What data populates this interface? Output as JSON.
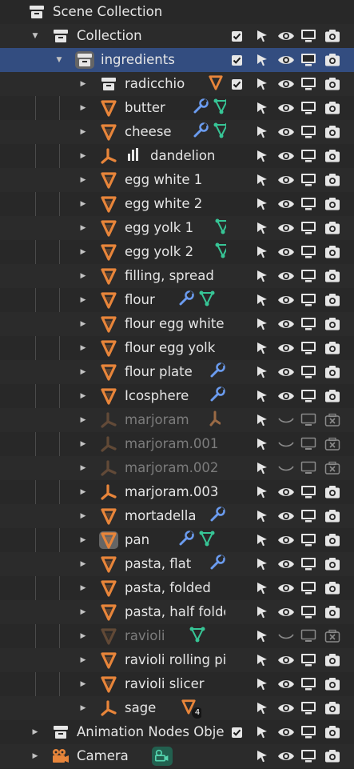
{
  "colors": {
    "background": "#282828",
    "selected_row": "#334d80",
    "mesh_icon": "#e8853a",
    "modifier_icon": "#6b9cf0",
    "vertex_group_icon": "#37c596",
    "control_icon": "#e6e6e6",
    "disabled_icon": "#8a8a8a"
  },
  "rows": [
    {
      "label": "Scene Collection",
      "depth": 0,
      "icon": "collection-icon",
      "expander": "none",
      "extras": [],
      "check": false,
      "controls": false,
      "dim": false,
      "selected": false
    },
    {
      "label": "Collection",
      "depth": 1,
      "icon": "collection-icon",
      "expander": "expanded",
      "extras": [],
      "check": true,
      "controls": true,
      "dim": false,
      "selected": false
    },
    {
      "label": "ingredients",
      "depth": 2,
      "icon": "collection-icon",
      "expander": "expanded",
      "extras": [],
      "check": true,
      "controls": true,
      "dim": false,
      "selected": true,
      "icon_highlight": true
    },
    {
      "label": "radicchio",
      "depth": 3,
      "icon": "collection-icon",
      "expander": "collapsed",
      "extras": [
        "mesh-data-icon"
      ],
      "check": true,
      "controls": true,
      "dim": false,
      "selected": false
    },
    {
      "label": "butter",
      "depth": 3,
      "icon": "mesh-object-icon",
      "expander": "collapsed",
      "extras": [
        "wrench-icon",
        "vertex-group-icon"
      ],
      "check": false,
      "controls": true,
      "dim": false,
      "selected": false
    },
    {
      "label": "cheese",
      "depth": 3,
      "icon": "mesh-object-icon",
      "expander": "collapsed",
      "extras": [
        "wrench-icon",
        "vertex-group-icon"
      ],
      "check": false,
      "controls": true,
      "dim": false,
      "selected": false
    },
    {
      "label": "dandelion",
      "depth": 3,
      "icon": "empty-object-icon",
      "expander": "collapsed",
      "extras": [
        "particles-icon"
      ],
      "check": false,
      "controls": true,
      "dim": false,
      "selected": false,
      "extras_before_name": true
    },
    {
      "label": "egg white 1",
      "depth": 3,
      "icon": "mesh-object-icon",
      "expander": "collapsed",
      "extras": [],
      "check": false,
      "controls": true,
      "dim": false,
      "selected": false
    },
    {
      "label": "egg white 2",
      "depth": 3,
      "icon": "mesh-object-icon",
      "expander": "collapsed",
      "extras": [],
      "check": false,
      "controls": true,
      "dim": false,
      "selected": false
    },
    {
      "label": "egg yolk 1",
      "depth": 3,
      "icon": "mesh-object-icon",
      "expander": "collapsed",
      "extras": [
        "vertex-group-icon"
      ],
      "check": false,
      "controls": true,
      "dim": false,
      "selected": false
    },
    {
      "label": "egg yolk 2",
      "depth": 3,
      "icon": "mesh-object-icon",
      "expander": "collapsed",
      "extras": [
        "vertex-group-icon"
      ],
      "check": false,
      "controls": true,
      "dim": false,
      "selected": false
    },
    {
      "label": "filling, spread",
      "depth": 3,
      "icon": "mesh-object-icon",
      "expander": "collapsed",
      "extras": [],
      "check": false,
      "controls": true,
      "dim": false,
      "selected": false
    },
    {
      "label": "flour",
      "depth": 3,
      "icon": "mesh-object-icon",
      "expander": "collapsed",
      "extras": [
        "wrench-icon",
        "vertex-group-icon"
      ],
      "check": false,
      "controls": true,
      "dim": false,
      "selected": false
    },
    {
      "label": "flour egg white",
      "depth": 3,
      "icon": "mesh-object-icon",
      "expander": "collapsed",
      "extras": [],
      "check": false,
      "controls": true,
      "dim": false,
      "selected": false
    },
    {
      "label": "flour egg yolk",
      "depth": 3,
      "icon": "mesh-object-icon",
      "expander": "collapsed",
      "extras": [],
      "check": false,
      "controls": true,
      "dim": false,
      "selected": false
    },
    {
      "label": "flour plate",
      "depth": 3,
      "icon": "mesh-object-icon",
      "expander": "collapsed",
      "extras": [
        "wrench-icon"
      ],
      "check": false,
      "controls": true,
      "dim": false,
      "selected": false
    },
    {
      "label": "Icosphere",
      "depth": 3,
      "icon": "mesh-object-icon",
      "expander": "collapsed",
      "extras": [
        "wrench-icon"
      ],
      "check": false,
      "controls": true,
      "dim": false,
      "selected": false
    },
    {
      "label": "marjoram",
      "depth": 3,
      "icon": "empty-object-icon",
      "expander": "collapsed",
      "extras": [
        "empty-data-icon"
      ],
      "check": false,
      "controls": true,
      "dim": true,
      "selected": false
    },
    {
      "label": "marjoram.001",
      "depth": 3,
      "icon": "empty-object-icon",
      "expander": "collapsed",
      "extras": [],
      "check": false,
      "controls": true,
      "dim": true,
      "selected": false
    },
    {
      "label": "marjoram.002",
      "depth": 3,
      "icon": "empty-object-icon",
      "expander": "collapsed",
      "extras": [],
      "check": false,
      "controls": true,
      "dim": true,
      "selected": false
    },
    {
      "label": "marjoram.003",
      "depth": 3,
      "icon": "empty-object-icon",
      "expander": "collapsed",
      "extras": [],
      "check": false,
      "controls": true,
      "dim": false,
      "selected": false
    },
    {
      "label": "mortadella",
      "depth": 3,
      "icon": "mesh-object-icon",
      "expander": "collapsed",
      "extras": [
        "wrench-icon"
      ],
      "check": false,
      "controls": true,
      "dim": false,
      "selected": false
    },
    {
      "label": "pan",
      "depth": 3,
      "icon": "mesh-object-icon",
      "expander": "collapsed",
      "extras": [
        "wrench-icon",
        "vertex-group-icon"
      ],
      "check": false,
      "controls": true,
      "dim": false,
      "selected": false,
      "icon_highlight": true
    },
    {
      "label": "pasta, flat",
      "depth": 3,
      "icon": "mesh-object-icon",
      "expander": "collapsed",
      "extras": [
        "wrench-icon"
      ],
      "check": false,
      "controls": true,
      "dim": false,
      "selected": false
    },
    {
      "label": "pasta, folded",
      "depth": 3,
      "icon": "mesh-object-icon",
      "expander": "collapsed",
      "extras": [],
      "check": false,
      "controls": true,
      "dim": false,
      "selected": false
    },
    {
      "label": "pasta, half folded",
      "depth": 3,
      "icon": "mesh-object-icon",
      "expander": "collapsed",
      "extras": [],
      "check": false,
      "controls": true,
      "dim": false,
      "selected": false
    },
    {
      "label": "ravioli",
      "depth": 3,
      "icon": "mesh-object-icon",
      "expander": "collapsed",
      "extras": [
        "vertex-group-icon"
      ],
      "check": false,
      "controls": true,
      "dim": true,
      "selected": false
    },
    {
      "label": "ravioli rolling pin",
      "depth": 3,
      "icon": "mesh-object-icon",
      "expander": "collapsed",
      "extras": [],
      "check": false,
      "controls": true,
      "dim": false,
      "selected": false
    },
    {
      "label": "ravioli slicer",
      "depth": 3,
      "icon": "mesh-object-icon",
      "expander": "collapsed",
      "extras": [],
      "check": false,
      "controls": true,
      "dim": false,
      "selected": false
    },
    {
      "label": "sage",
      "depth": 3,
      "icon": "empty-object-icon",
      "expander": "collapsed",
      "extras": [
        "mesh-data-icon"
      ],
      "badge": "4",
      "check": false,
      "controls": true,
      "dim": false,
      "selected": false
    },
    {
      "label": "Animation Nodes Object",
      "depth": 1,
      "icon": "collection-icon",
      "expander": "collapsed",
      "extras": [],
      "check": true,
      "controls": true,
      "dim": false,
      "selected": false
    },
    {
      "label": "Camera",
      "depth": 1,
      "icon": "camera-object-icon",
      "expander": "collapsed",
      "extras": [
        "camera-data-icon"
      ],
      "check": false,
      "controls": true,
      "dim": false,
      "selected": false
    }
  ]
}
